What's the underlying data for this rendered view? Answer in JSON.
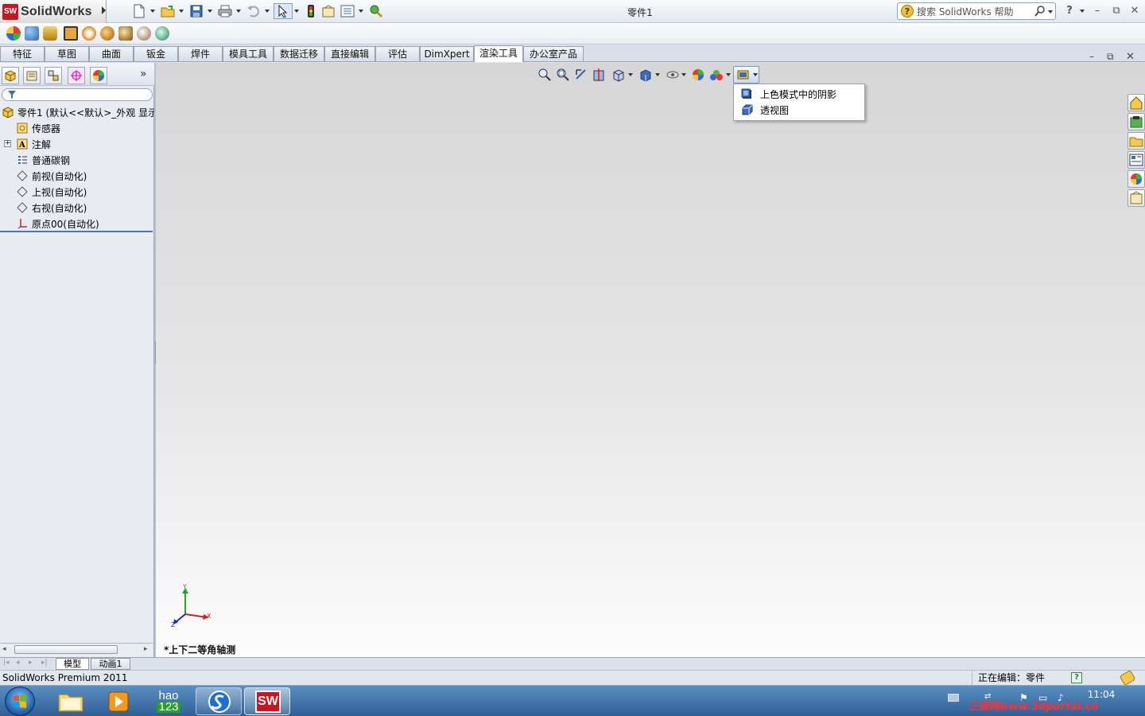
{
  "app": {
    "logo_mark": "SW",
    "logo_text": "SolidWorks",
    "document_title": "零件1"
  },
  "search": {
    "placeholder": "搜索 SolidWorks 帮助",
    "icon": "question-icon"
  },
  "window_controls": {
    "help": "?",
    "minimize": "–",
    "restore": "⧉",
    "close": "✕"
  },
  "colors": {
    "accent": "#4a77b4",
    "logo_red": "#c8161e",
    "taskbar": "#2f5f97"
  },
  "command_tabs": [
    "特征",
    "草图",
    "曲面",
    "钣金",
    "焊件",
    "模具工具",
    "数据迁移",
    "直接编辑",
    "评估",
    "DimXpert",
    "渲染工具",
    "办公室产品"
  ],
  "active_tab": "渲染工具",
  "feature_tree": {
    "root": "零件1 (默认<<默认>_外观 显示",
    "items": [
      {
        "label": "传感器",
        "icon": "sensor-icon"
      },
      {
        "label": "注解",
        "icon": "annotation-icon"
      },
      {
        "label": "普通碳钢",
        "icon": "material-icon"
      },
      {
        "label": "前视(自动化)",
        "icon": "plane-icon"
      },
      {
        "label": "上视(自动化)",
        "icon": "plane-icon"
      },
      {
        "label": "右视(自动化)",
        "icon": "plane-icon"
      },
      {
        "label": "原点00(自动化)",
        "icon": "origin-icon"
      }
    ]
  },
  "display_menu": {
    "items": [
      "上色模式中的阴影",
      "透视图"
    ]
  },
  "triad": {
    "x": "X",
    "y": "Y",
    "z": "Z"
  },
  "view_label": "*上下二等角轴测",
  "bottom_tabs": [
    "模型",
    "动画1"
  ],
  "status": {
    "left": "SolidWorks Premium 2011",
    "editing": "正在编辑：零件"
  },
  "taskbar": {
    "clock": "11:04",
    "hao_top": "hao",
    "hao_bottom": "123",
    "sw_label": "SW",
    "watermark": "三维网www.3dportal.cn"
  }
}
